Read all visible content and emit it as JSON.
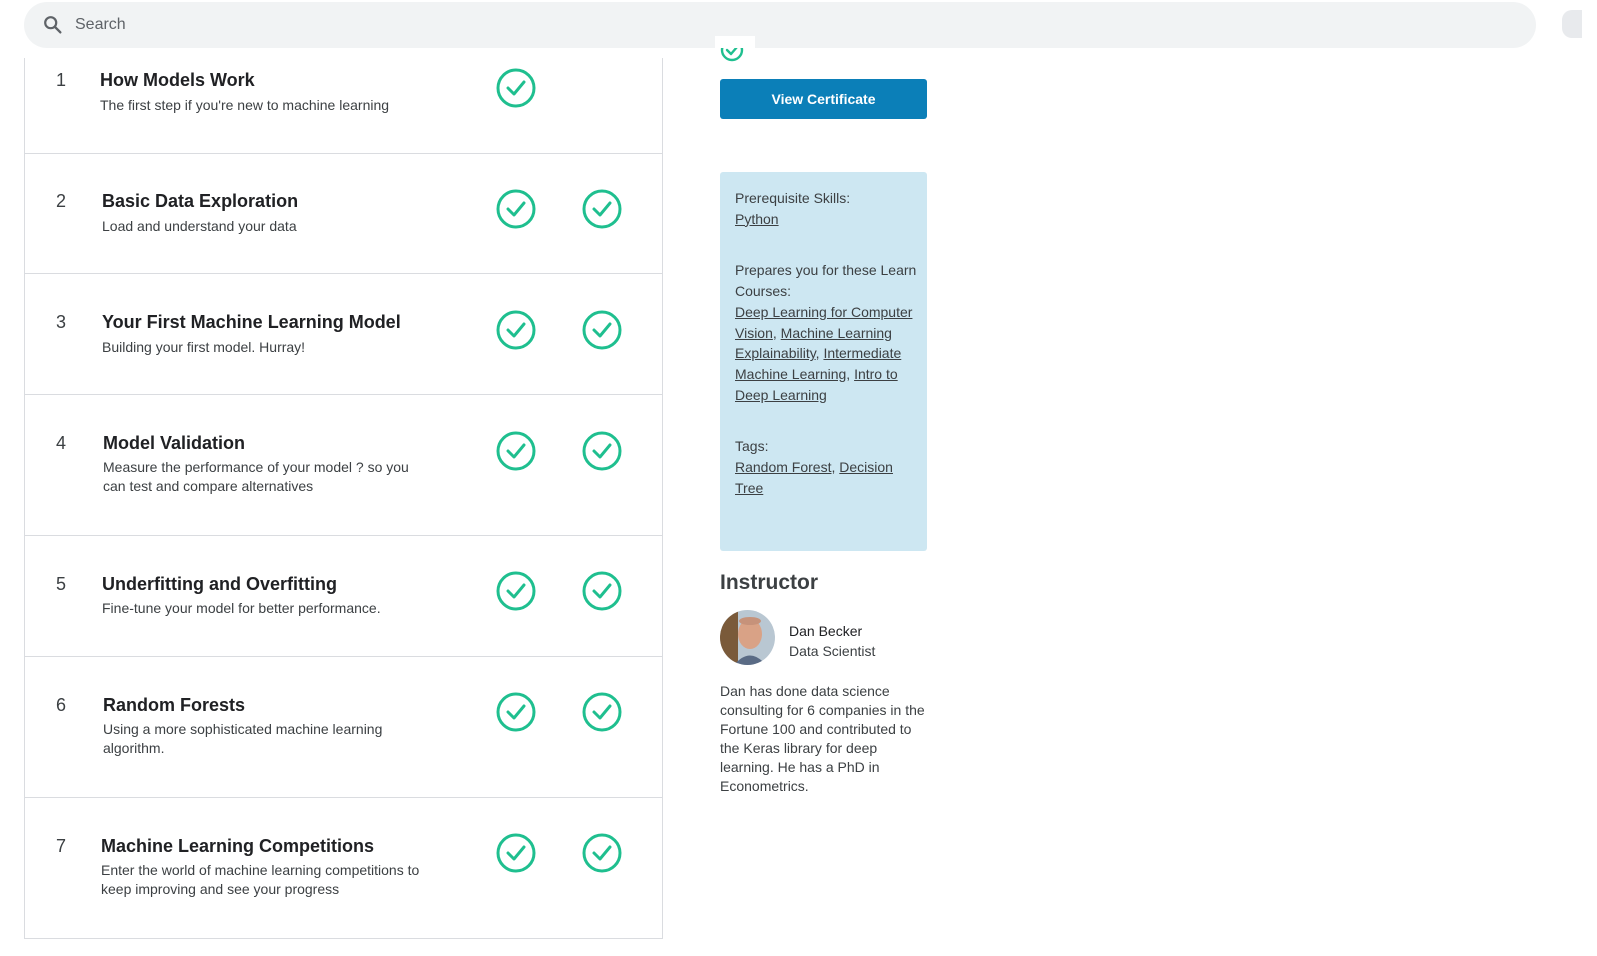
{
  "search": {
    "placeholder": "Search"
  },
  "lessons": [
    {
      "number": "1",
      "title": "How Models Work",
      "description": "The first step if you're new to machine learning",
      "check1": true,
      "check2": false
    },
    {
      "number": "2",
      "title": "Basic Data Exploration",
      "description": "Load and understand your data",
      "check1": true,
      "check2": true
    },
    {
      "number": "3",
      "title": "Your First Machine Learning Model",
      "description": "Building your first model. Hurray!",
      "check1": true,
      "check2": true
    },
    {
      "number": "4",
      "title": "Model Validation",
      "description": "Measure the performance of your model ? so you can test and compare alternatives",
      "check1": true,
      "check2": true
    },
    {
      "number": "5",
      "title": "Underfitting and Overfitting",
      "description": "Fine-tune your model for better performance.",
      "check1": true,
      "check2": true
    },
    {
      "number": "6",
      "title": "Random Forests",
      "description": "Using a more sophisticated machine learning algorithm.",
      "check1": true,
      "check2": true
    },
    {
      "number": "7",
      "title": "Machine Learning Competitions",
      "description": "Enter the world of machine learning competitions to keep improving and see your progress",
      "check1": true,
      "check2": true
    }
  ],
  "certificate": {
    "button_label": "View Certificate"
  },
  "info": {
    "prereq_label": "Prerequisite Skills:",
    "prereq_link": "Python",
    "prepares_label": "Prepares you for these Learn Courses:",
    "course_links": [
      "Deep Learning for Computer Vision",
      "Machine Learning Explainability",
      "Intermediate Machine Learning",
      "Intro to Deep Learning"
    ],
    "tags_label": "Tags:",
    "tags": [
      "Random Forest",
      "Decision Tree"
    ]
  },
  "instructor": {
    "heading": "Instructor",
    "name": "Dan Becker",
    "role": "Data Scientist",
    "bio": "Dan has done data science consulting for 6 companies in the Fortune 100 and contributed to the Keras library for deep learning. He has a PhD in Econometrics."
  },
  "colors": {
    "check": "#20beff",
    "check_green": "#1fbf8f",
    "button": "#0b7fb8",
    "info_bg": "#cde7f2"
  },
  "icons": {
    "search": "search-icon",
    "check": "check-circle-icon",
    "avatar": "avatar"
  }
}
